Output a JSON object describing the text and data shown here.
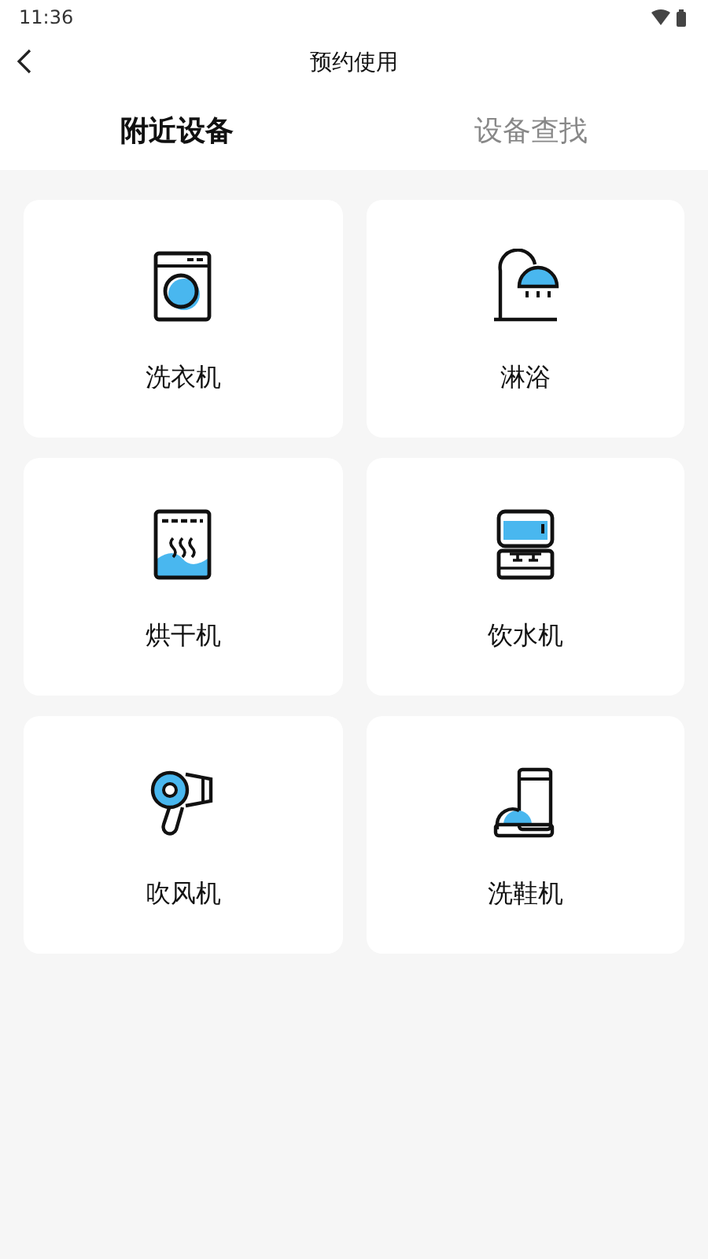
{
  "status_bar": {
    "time": "11:36"
  },
  "header": {
    "title": "预约使用"
  },
  "tabs": [
    {
      "label": "附近设备",
      "selected": true
    },
    {
      "label": "设备查找",
      "selected": false
    }
  ],
  "devices": [
    {
      "kind": "washer",
      "label": "洗衣机"
    },
    {
      "kind": "shower",
      "label": "淋浴"
    },
    {
      "kind": "dryer",
      "label": "烘干机"
    },
    {
      "kind": "water-dispenser",
      "label": "饮水机"
    },
    {
      "kind": "hair-dryer",
      "label": "吹风机"
    },
    {
      "kind": "shoe-washer",
      "label": "洗鞋机"
    }
  ]
}
